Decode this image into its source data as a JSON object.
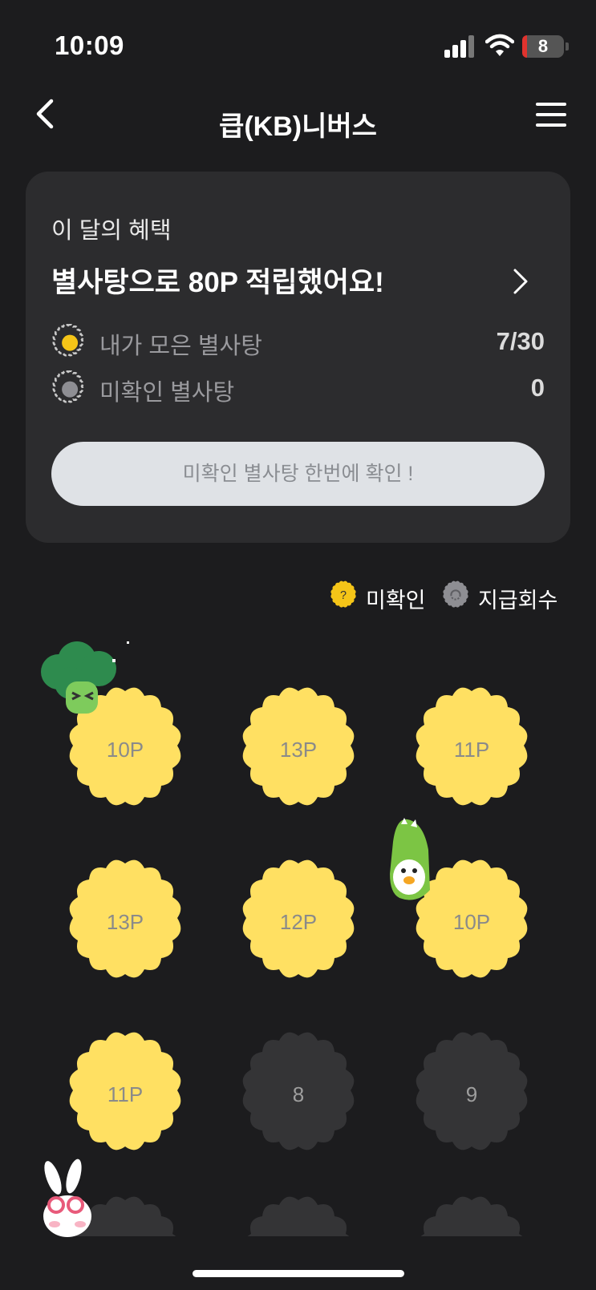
{
  "status_bar": {
    "time": "10:09",
    "battery": "8"
  },
  "nav": {
    "title": "큽(KB)니버스"
  },
  "benefit": {
    "subtitle": "이 달의 혜택",
    "headline": "별사탕으로 80P 적립했어요!",
    "collected_label": "내가 모은 별사탕",
    "collected_value": "7/30",
    "unconfirmed_label": "미확인 별사탕",
    "unconfirmed_value": "0",
    "confirm_button": "미확인 별사탕 한번에 확인 !"
  },
  "legend": {
    "unconfirmed": "미확인",
    "revoked": "지급회수"
  },
  "candies": [
    {
      "label": "10P",
      "collected": true
    },
    {
      "label": "13P",
      "collected": true
    },
    {
      "label": "11P",
      "collected": true
    },
    {
      "label": "13P",
      "collected": true
    },
    {
      "label": "12P",
      "collected": true
    },
    {
      "label": "10P",
      "collected": true
    },
    {
      "label": "11P",
      "collected": true
    },
    {
      "label": "8",
      "collected": false
    },
    {
      "label": "9",
      "collected": false
    }
  ],
  "colors": {
    "candy_yellow": "#ffe062",
    "candy_empty": "#343436",
    "background": "#1c1c1e",
    "card": "#2c2c2e"
  }
}
